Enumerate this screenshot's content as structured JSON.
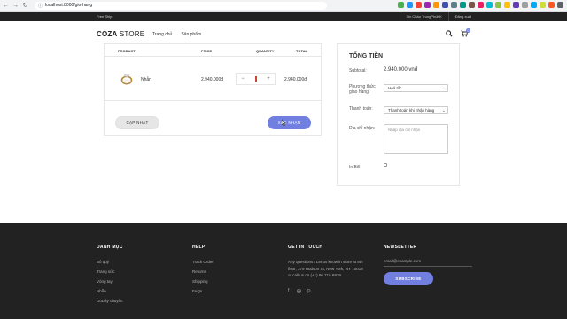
{
  "browser": {
    "url": "localhost:8000/gio-hang"
  },
  "topbar": {
    "free_ship": "Free Ship",
    "user_name": "Xin Chào TrungPhúKK",
    "logout": "Đăng xuất"
  },
  "header": {
    "logo_bold": "COZA",
    "logo_rest": " STORE",
    "menu": [
      "Trang chủ",
      "Sản phẩm"
    ],
    "cart_badge": "0"
  },
  "cart": {
    "columns": {
      "product": "PRODUCT",
      "price": "PRICE",
      "quantity": "QUANTITY",
      "total": "TOTAL"
    },
    "items": [
      {
        "name": "Nhẫn",
        "price": "2.940.000đ",
        "quantity": "1",
        "total": "2.940.000đ"
      }
    ],
    "update_label": "CẬP NHẬT",
    "confirm_label": "XÁC NHẬN"
  },
  "totals": {
    "title": "TỔNG TIỀN",
    "subtotal_label": "Subtotal:",
    "subtotal_value": "2.940.000 vnđ",
    "shipping_label": "Phương thức giao hàng:",
    "shipping_value": "Hoả tốc",
    "payment_label": "Thanh toán:",
    "payment_value": "Thanh toán khi nhận hàng",
    "address_label": "Địa chỉ nhận:",
    "address_placeholder": "Nhập địa chỉ nhận",
    "print_label": "In Bill"
  },
  "footer": {
    "categories": {
      "title": "DANH MỤC",
      "items": [
        "Bô quý",
        "Trang sức",
        "Vòng tay",
        "Nhẫn",
        "DoDây chuyền"
      ]
    },
    "help": {
      "title": "HELP",
      "items": [
        "Track Order",
        "Returns",
        "Shipping",
        "FAQs"
      ]
    },
    "contact": {
      "title": "GET IN TOUCH",
      "text": "Any questions? Let us know in store at 8th floor, 379 Hudson St, New York, NY 10018 or call us on (+1) 96 716 6879"
    },
    "newsletter": {
      "title": "NEWSLETTER",
      "email": "email@example.com",
      "button": "SUBSCRIBE"
    }
  },
  "colors": {
    "accent": "#717fe0",
    "footer_bg": "#222222",
    "topbar_bg": "#222222"
  }
}
